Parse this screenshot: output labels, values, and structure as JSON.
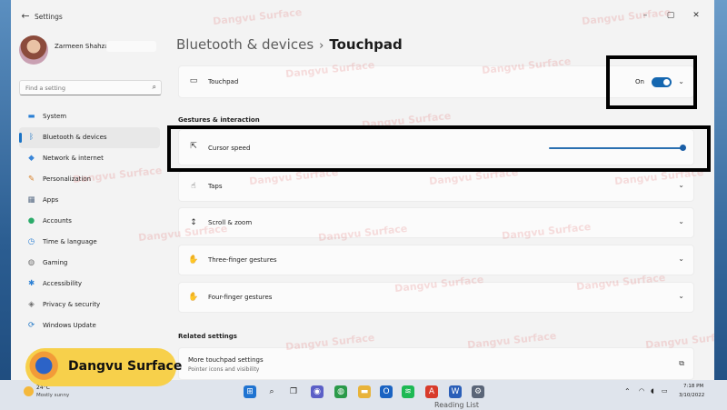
{
  "window": {
    "app_title": "Settings",
    "back_icon": "back-arrow-icon",
    "controls": [
      "–",
      "▢",
      "✕"
    ]
  },
  "profile": {
    "name": "Zarmeen Shahzad"
  },
  "search": {
    "placeholder": "Find a setting"
  },
  "sidebar": {
    "items": [
      {
        "label": "System",
        "icon": "monitor-icon",
        "color": "#2a7fd4",
        "active": false
      },
      {
        "label": "Bluetooth & devices",
        "icon": "bluetooth-icon",
        "color": "#1a73c5",
        "active": true
      },
      {
        "label": "Network & internet",
        "icon": "wifi-icon",
        "color": "#3a86d8",
        "active": false
      },
      {
        "label": "Personalization",
        "icon": "brush-icon",
        "color": "#d9822b",
        "active": false
      },
      {
        "label": "Apps",
        "icon": "apps-icon",
        "color": "#5a6d86",
        "active": false
      },
      {
        "label": "Accounts",
        "icon": "person-icon",
        "color": "#2bab6a",
        "active": false
      },
      {
        "label": "Time & language",
        "icon": "globe-clock-icon",
        "color": "#2a7fd4",
        "active": false
      },
      {
        "label": "Gaming",
        "icon": "gamepad-icon",
        "color": "#6b6b6b",
        "active": false
      },
      {
        "label": "Accessibility",
        "icon": "accessibility-icon",
        "color": "#2a7fd4",
        "active": false
      },
      {
        "label": "Privacy & security",
        "icon": "shield-icon",
        "color": "#6b6b6b",
        "active": false
      },
      {
        "label": "Windows Update",
        "icon": "update-icon",
        "color": "#1a73c5",
        "active": false
      }
    ]
  },
  "breadcrumb": {
    "parent": "Bluetooth & devices",
    "separator": "›",
    "current": "Touchpad"
  },
  "touchpad": {
    "label": "Touchpad",
    "toggle_state": "On",
    "enabled": true
  },
  "gestures": {
    "section_title": "Gestures & interaction",
    "cursor_speed": {
      "label": "Cursor speed",
      "value_fraction": 1.0
    },
    "items": [
      {
        "label": "Taps",
        "icon": "tap-icon"
      },
      {
        "label": "Scroll & zoom",
        "icon": "scroll-icon"
      },
      {
        "label": "Three-finger gestures",
        "icon": "hand-icon"
      },
      {
        "label": "Four-finger gestures",
        "icon": "hand-icon"
      }
    ]
  },
  "related": {
    "section_title": "Related settings",
    "more_touchpad": {
      "title": "More touchpad settings",
      "subtitle": "Pointer icons and visibility"
    }
  },
  "watermark": {
    "text": "Dangvu Surface"
  },
  "logo": {
    "text": "Dangvu Surface"
  },
  "taskbar": {
    "weather_temp": "24°C",
    "weather_desc": "Mostly sunny",
    "time": "7:18 PM",
    "date": "3/10/2022",
    "reading_list": "Reading List"
  },
  "colors": {
    "accent": "#1567b0",
    "window_bg": "#f3f3f3",
    "card_bg": "#fbfbfb",
    "highlight_border": "#000000",
    "logo_bg": "#f7d04b"
  }
}
